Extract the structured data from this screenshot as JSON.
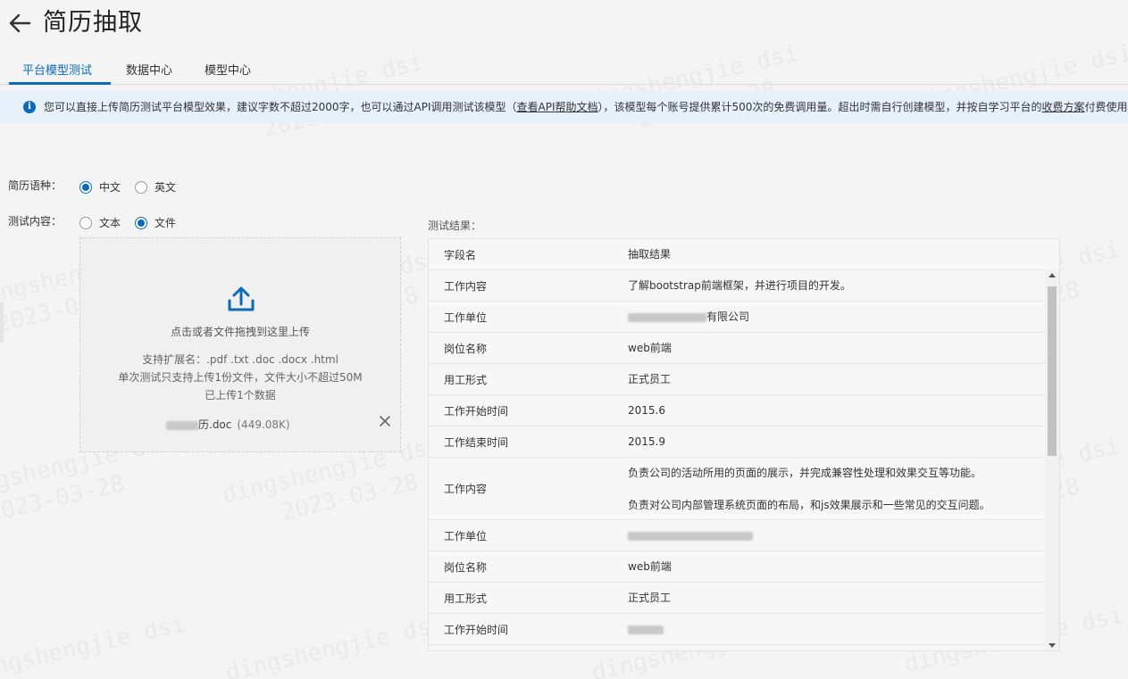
{
  "header": {
    "title": "简历抽取"
  },
  "tabs": [
    {
      "label": "平台模型测试",
      "active": true
    },
    {
      "label": "数据中心",
      "active": false
    },
    {
      "label": "模型中心",
      "active": false
    }
  ],
  "notice": {
    "text_before": "您可以直接上传简历测试平台模型效果，建议字数不超过2000字，也可以通过API调用测试该模型（",
    "api_link": "查看API帮助文档",
    "text_middle": "），该模型每个账号提供累计500次的免费调用量。超出时需自行创建模型，并按自学习平台的",
    "fee_link": "收费方案",
    "text_after": "付费使用。"
  },
  "form": {
    "language_label": "简历语种：",
    "language_options": [
      "中文",
      "英文"
    ],
    "language_selected": "中文",
    "content_label": "测试内容：",
    "content_options": [
      "文本",
      "文件"
    ],
    "content_selected": "文件"
  },
  "upload": {
    "hint": "点击或者文件拖拽到这里上传",
    "formats": "支持扩展名：.pdf .txt .doc .docx .html",
    "limit": "单次测试只支持上传1份文件，文件大小不超过50M",
    "count": "已上传1个数据",
    "file_name_suffix": "历.doc",
    "file_size": "(449.08K)"
  },
  "results": {
    "label": "测试结果：",
    "headers": [
      "字段名",
      "抽取结果"
    ],
    "rows": [
      {
        "field": "工作内容",
        "value": "了解bootstrap前端框架，并进行项目的开发。"
      },
      {
        "field": "工作单位",
        "value": "有限公司"
      },
      {
        "field": "岗位名称",
        "value": "web前端"
      },
      {
        "field": "用工形式",
        "value": "正式员工"
      },
      {
        "field": "工作开始时间",
        "value": "2015.6"
      },
      {
        "field": "工作结束时间",
        "value": "2015.9"
      },
      {
        "field": "工作内容",
        "value": "负责公司的活动所用的页面的展示，并完成兼容性处理和效果交互等功能。",
        "value2": "负责对公司内部管理系统页面的布局，和js效果展示和一些常见的交互问题。"
      },
      {
        "field": "工作单位",
        "value": ""
      },
      {
        "field": "岗位名称",
        "value": "web前端"
      },
      {
        "field": "用工形式",
        "value": "正式员工"
      },
      {
        "field": "工作开始时间",
        "value": ""
      }
    ]
  },
  "watermark": {
    "line1": "dingshengjie dsi",
    "line2": "2023-03-28"
  },
  "colors": {
    "accent": "#0b6bb8",
    "notice_bg": "#e6f1fb"
  }
}
